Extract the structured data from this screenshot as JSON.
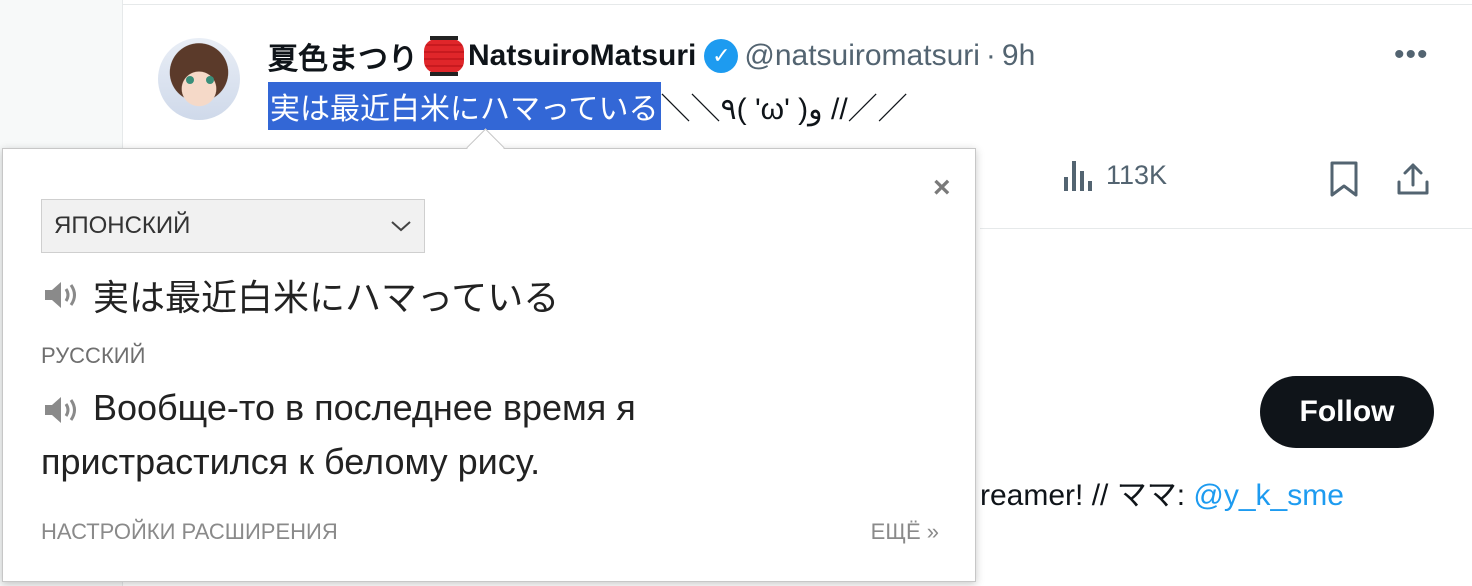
{
  "tweet": {
    "display_name": "夏色まつり",
    "display_name_latin": "NatsuiroMatsuri",
    "handle": "@natsuiromatsuri",
    "separator": "·",
    "time": "9h",
    "more_label": "•••",
    "text_selected": "実は最近白米にハマっている",
    "text_rest": "＼＼٩( 'ω' )و //／／",
    "views": "113K"
  },
  "profile": {
    "follow_label": "Follow",
    "bio_fragment": "reamer! // ママ: ",
    "bio_mention": "@y_k_sme"
  },
  "translator_popup": {
    "close_label": "×",
    "source_language": "ЯПОНСКИЙ",
    "source_text": "実は最近白米にハマっている",
    "target_language": "РУССКИЙ",
    "translation": "Вообще-то в последнее время я пристрастился к белому рису.",
    "settings_label": "НАСТРОЙКИ РАСШИРЕНИЯ",
    "more_label": "ЕЩЁ »"
  },
  "colors": {
    "selection": "#3367d6",
    "verified": "#1d9bf0",
    "mention": "#1d9bf0",
    "follow_bg": "#0f1419"
  }
}
